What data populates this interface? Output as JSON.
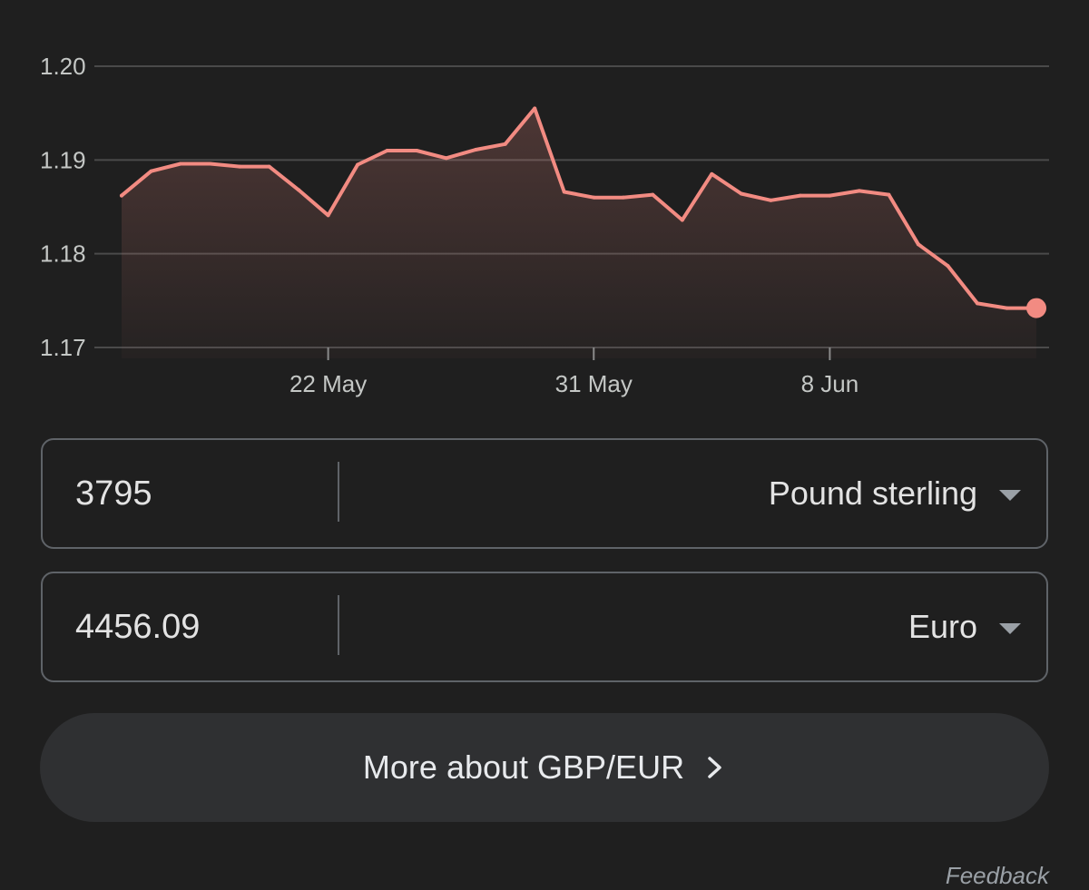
{
  "chart_data": {
    "type": "area",
    "y_ticks": [
      "1.20",
      "1.19",
      "1.18",
      "1.17"
    ],
    "ylim": [
      1.17,
      1.2
    ],
    "x_ticks": [
      {
        "label": "22 May",
        "index": 7
      },
      {
        "label": "31 May",
        "index": 16
      },
      {
        "label": "8 Jun",
        "index": 24
      }
    ],
    "values": [
      1.1862,
      1.1888,
      1.1896,
      1.1896,
      1.1893,
      1.1893,
      1.1868,
      1.1841,
      1.1895,
      1.191,
      1.191,
      1.1902,
      1.1911,
      1.1917,
      1.1955,
      1.1866,
      1.186,
      1.186,
      1.1863,
      1.1836,
      1.1885,
      1.1864,
      1.1857,
      1.1862,
      1.1862,
      1.1867,
      1.1863,
      1.181,
      1.1787,
      1.1747,
      1.1742,
      1.1742
    ],
    "colors": {
      "line": "#f28b82",
      "fill": "#f28b82",
      "grid": "#4a4a4a",
      "axis_text": "#c4c7c5"
    }
  },
  "converter": {
    "from": {
      "amount": "3795",
      "currency": "Pound sterling"
    },
    "to": {
      "amount": "4456.09",
      "currency": "Euro"
    }
  },
  "more_button": {
    "label": "More about GBP/EUR",
    "icon": "chevron-right-icon"
  },
  "feedback": {
    "label": "Feedback"
  }
}
